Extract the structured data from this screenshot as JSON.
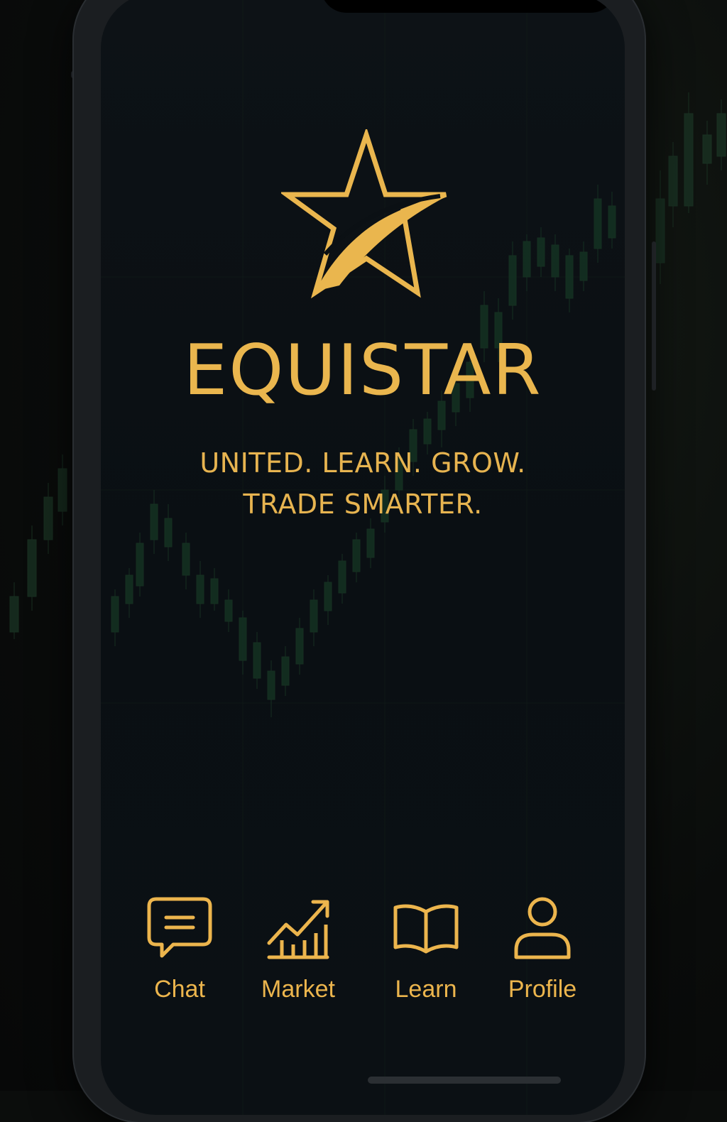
{
  "app": {
    "name": "EQUISTAR",
    "tagline_line1": "UNITED. LEARN. GROW.",
    "tagline_line2": "TRADE SMARTER."
  },
  "nav": {
    "items": [
      {
        "label": "Chat",
        "icon": "chat-bubble-icon"
      },
      {
        "label": "Market",
        "icon": "market-chart-icon"
      },
      {
        "label": "Learn",
        "icon": "open-book-icon"
      },
      {
        "label": "Profile",
        "icon": "user-profile-icon"
      }
    ]
  },
  "colors": {
    "accent_gold": "#eab64e",
    "background": "#0a0f13",
    "candle_green": "#1f4a33"
  }
}
